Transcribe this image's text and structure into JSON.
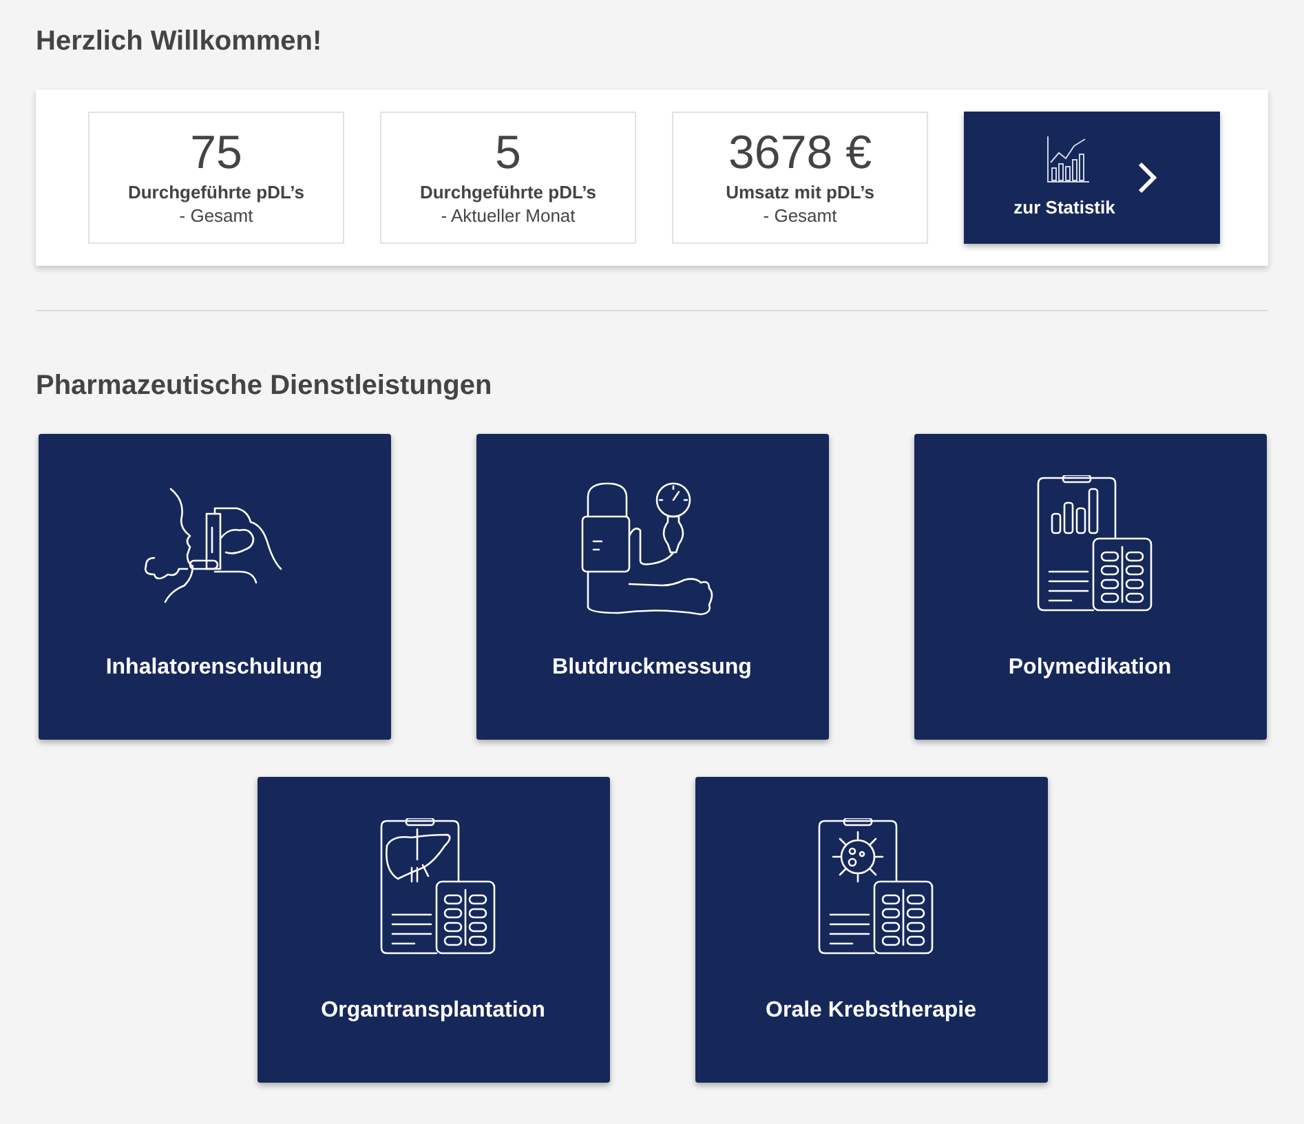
{
  "greeting": "Herzlich Willkommen!",
  "stats": [
    {
      "value": "75",
      "label": "Durchgeführte pDL’s",
      "sublabel": "- Gesamt"
    },
    {
      "value": "5",
      "label": "Durchgeführte pDL’s",
      "sublabel": "- Aktueller Monat"
    },
    {
      "value": "3678 €",
      "label": "Umsatz mit pDL’s",
      "sublabel": "- Gesamt"
    }
  ],
  "stats_button": {
    "label": "zur Statistik"
  },
  "services_title": "Pharmazeutische Dienstleistungen",
  "services": [
    {
      "label": "Inhalatorenschulung",
      "kind": "inhaler"
    },
    {
      "label": "Blutdruckmessung",
      "kind": "bloodpressure"
    },
    {
      "label": "Polymedikation",
      "kind": "chart"
    },
    {
      "label": "Organtransplantation",
      "kind": "liver"
    },
    {
      "label": "Orale Krebstherapie",
      "kind": "cell"
    }
  ]
}
